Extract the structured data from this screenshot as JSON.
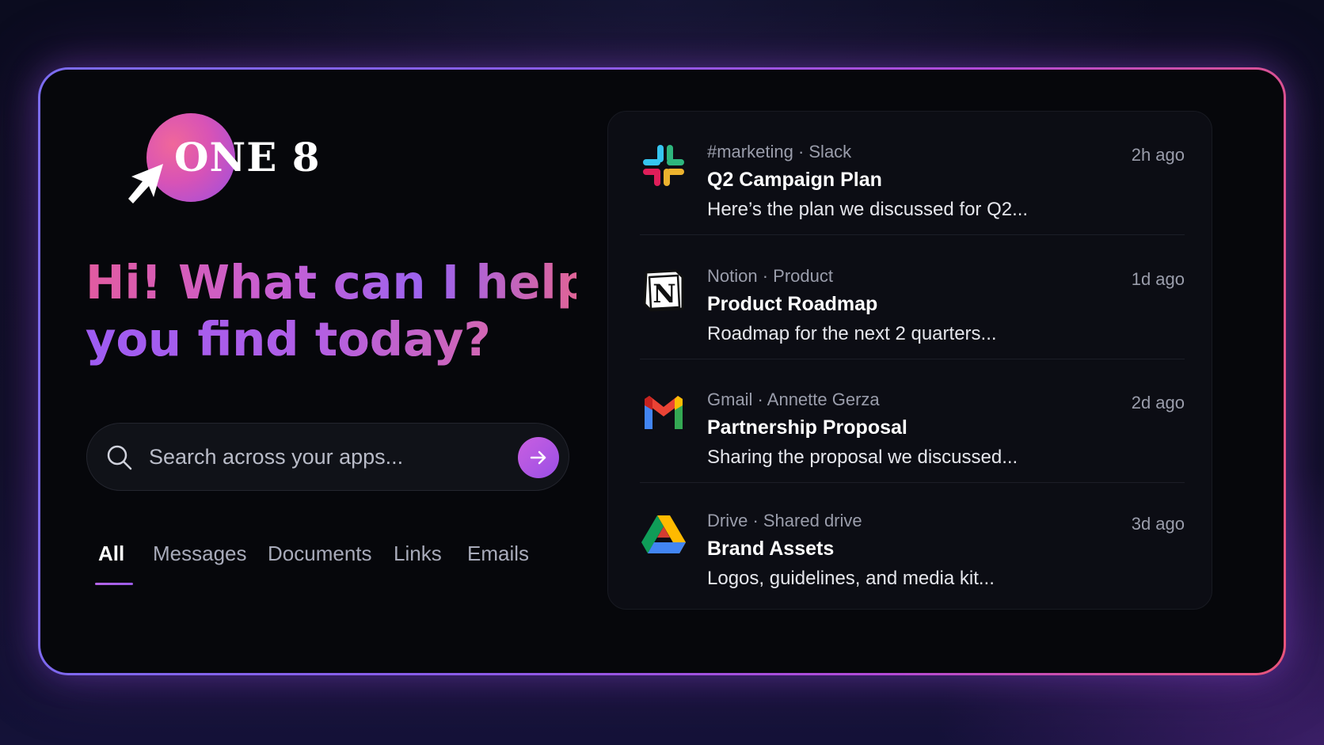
{
  "brand": {
    "logo_text": "ONE 8"
  },
  "headline": {
    "line1": "Hi! What can I help",
    "line2": "you find today?"
  },
  "search": {
    "placeholder": "Search across your apps..."
  },
  "tabs": [
    {
      "label": "All",
      "active": true
    },
    {
      "label": "Messages",
      "active": false
    },
    {
      "label": "Documents",
      "active": false
    },
    {
      "label": "Links",
      "active": false
    },
    {
      "label": "Emails",
      "active": false
    }
  ],
  "results": [
    {
      "app": "slack-icon",
      "source": "#marketing · Slack",
      "title": "Q2 Campaign Plan",
      "snippet": "Here’s the plan we discussed for Q2...",
      "time": "2h ago"
    },
    {
      "app": "notion-icon",
      "source": "Notion · Product",
      "title": "Product Roadmap",
      "snippet": "Roadmap for the next 2 quarters...",
      "time": "1d ago"
    },
    {
      "app": "gmail-icon",
      "source": "Gmail · Annette Gerza",
      "title": "Partnership Proposal",
      "snippet": "Sharing the proposal we discussed...",
      "time": "2d ago"
    },
    {
      "app": "google-drive-icon",
      "source": "Drive · Shared drive",
      "title": "Brand Assets",
      "snippet": "Logos, guidelines, and media kit...",
      "time": "3d ago"
    }
  ],
  "colors": {
    "accent": "#a855f7",
    "pink": "#e25ba0",
    "card_bg": "#06070b"
  }
}
